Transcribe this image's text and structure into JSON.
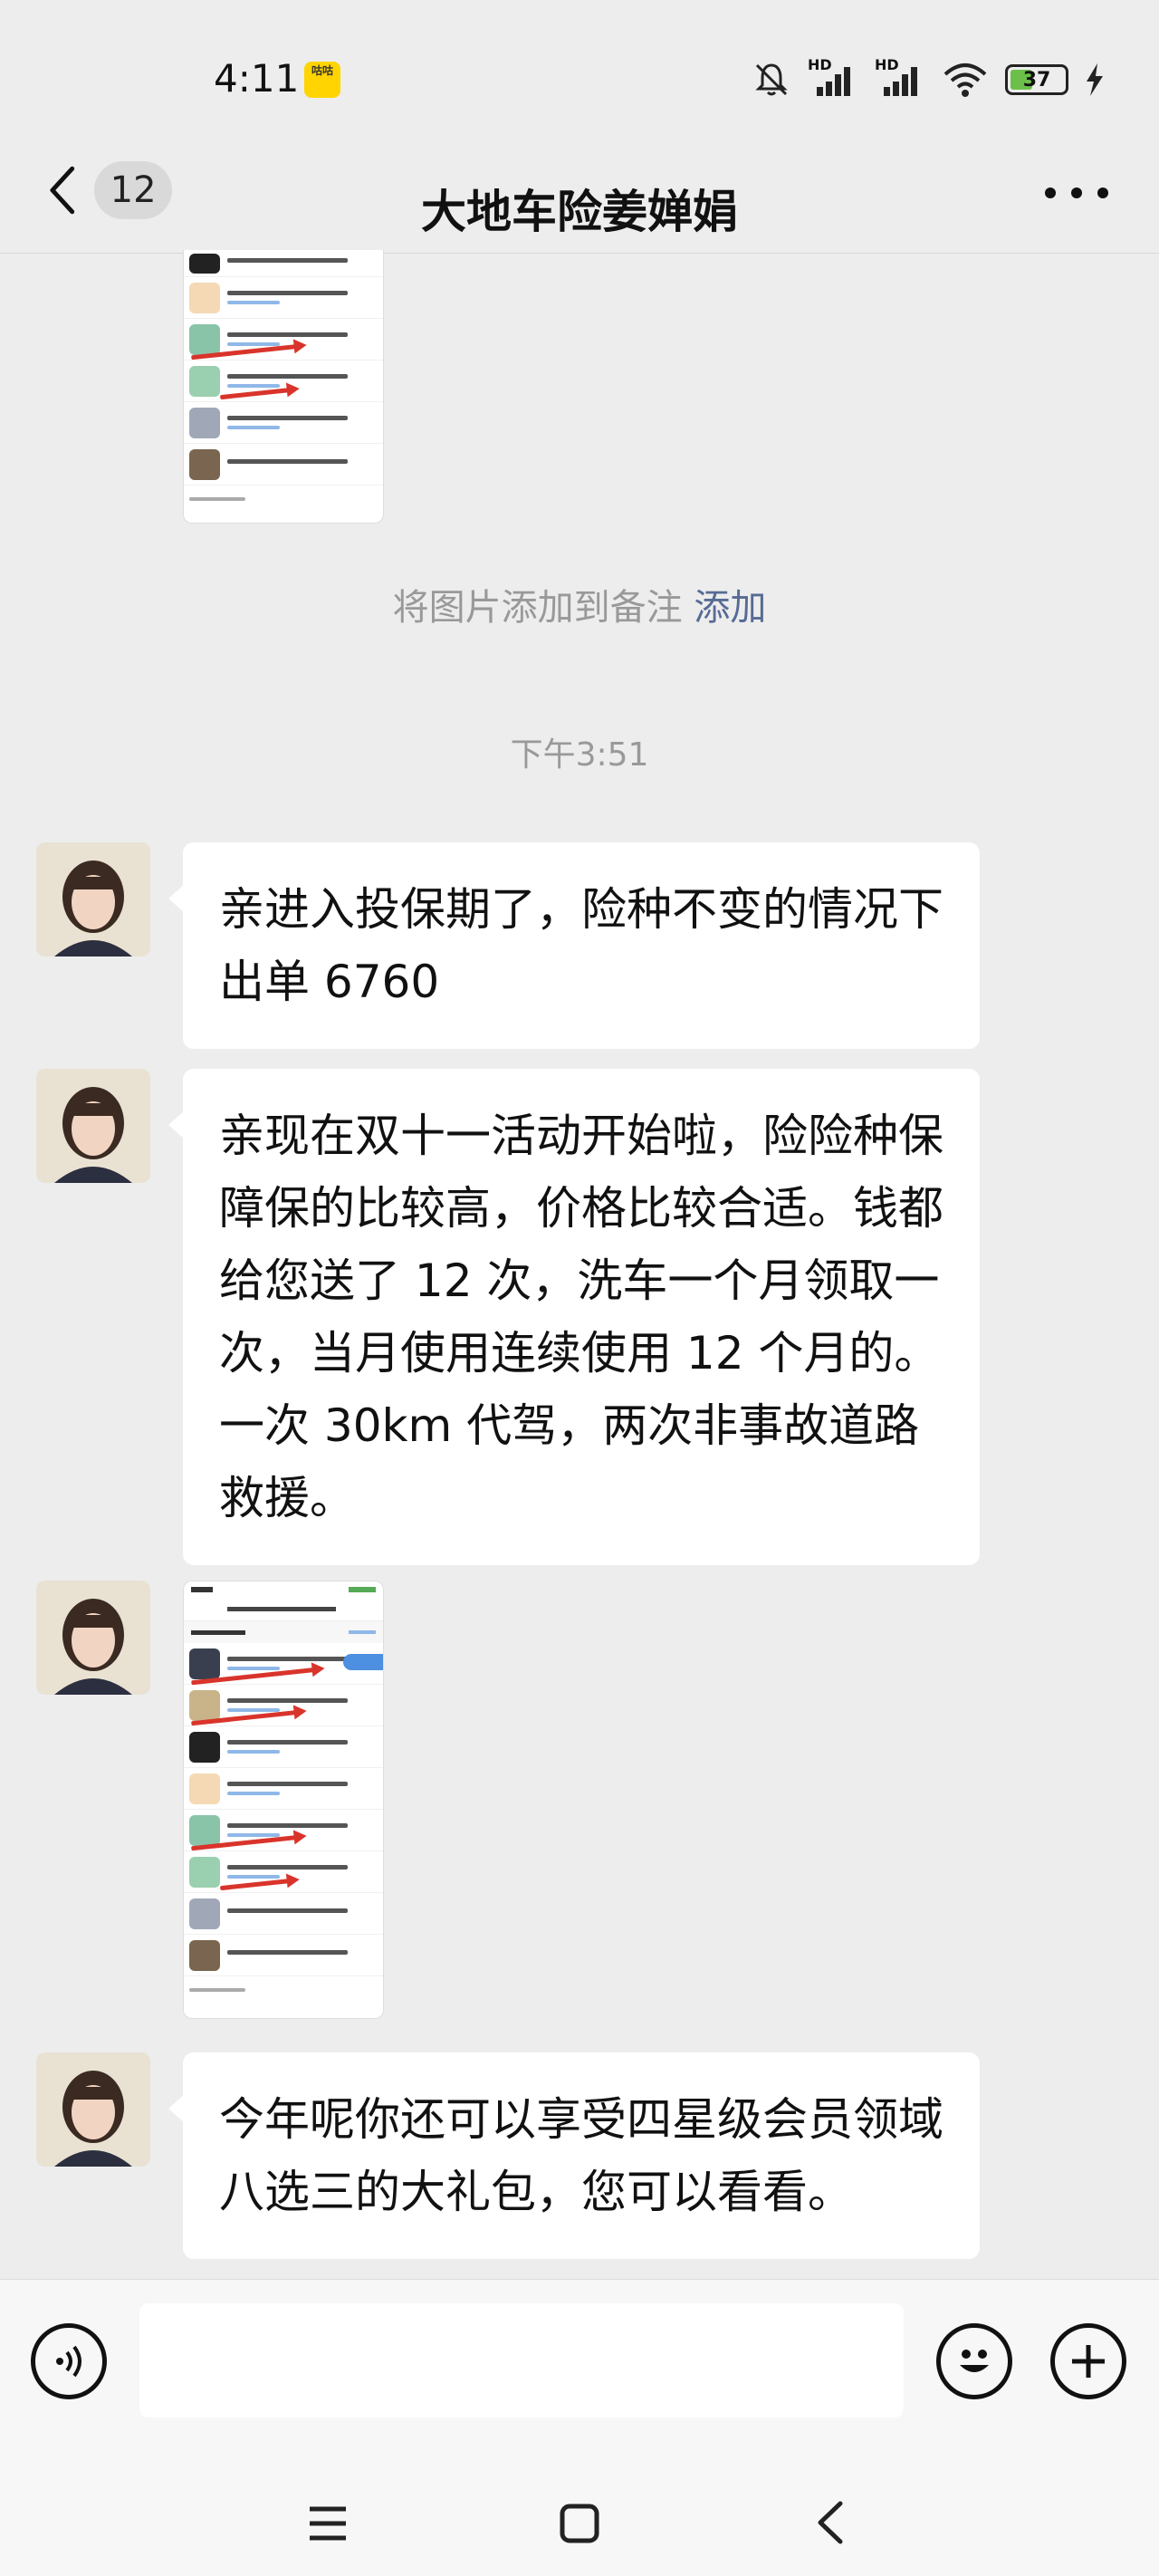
{
  "status_bar": {
    "time": "4:11",
    "app_badge": "咕咕",
    "battery": "37",
    "hd1": "HD",
    "hd2": "HD"
  },
  "header": {
    "unread_count": "12",
    "title": "大地车险姜婵娟"
  },
  "chat": {
    "note_text": "将图片添加到备注",
    "note_action": "添加",
    "timestamp": "下午3:51",
    "messages": [
      {
        "type": "text",
        "text": "亲进入投保期了，险种不变的情况下出单 6760"
      },
      {
        "type": "text",
        "text": "亲现在双十一活动开始啦，险险种保障保的比较高，价格比较合适。钱都给您送了 12 次，洗车一个月领取一次，当月使用连续使用 12 个月的。一次 30km 代驾，两次非事故道路救援。"
      },
      {
        "type": "image"
      },
      {
        "type": "text",
        "text": "今年呢你还可以享受四星级会员领域八选三的大礼包，您可以看看。"
      }
    ]
  },
  "input": {
    "placeholder": ""
  },
  "colors": {
    "background": "#ededed",
    "bubble": "#ffffff",
    "link": "#576b95",
    "arrow": "#d9342b"
  }
}
